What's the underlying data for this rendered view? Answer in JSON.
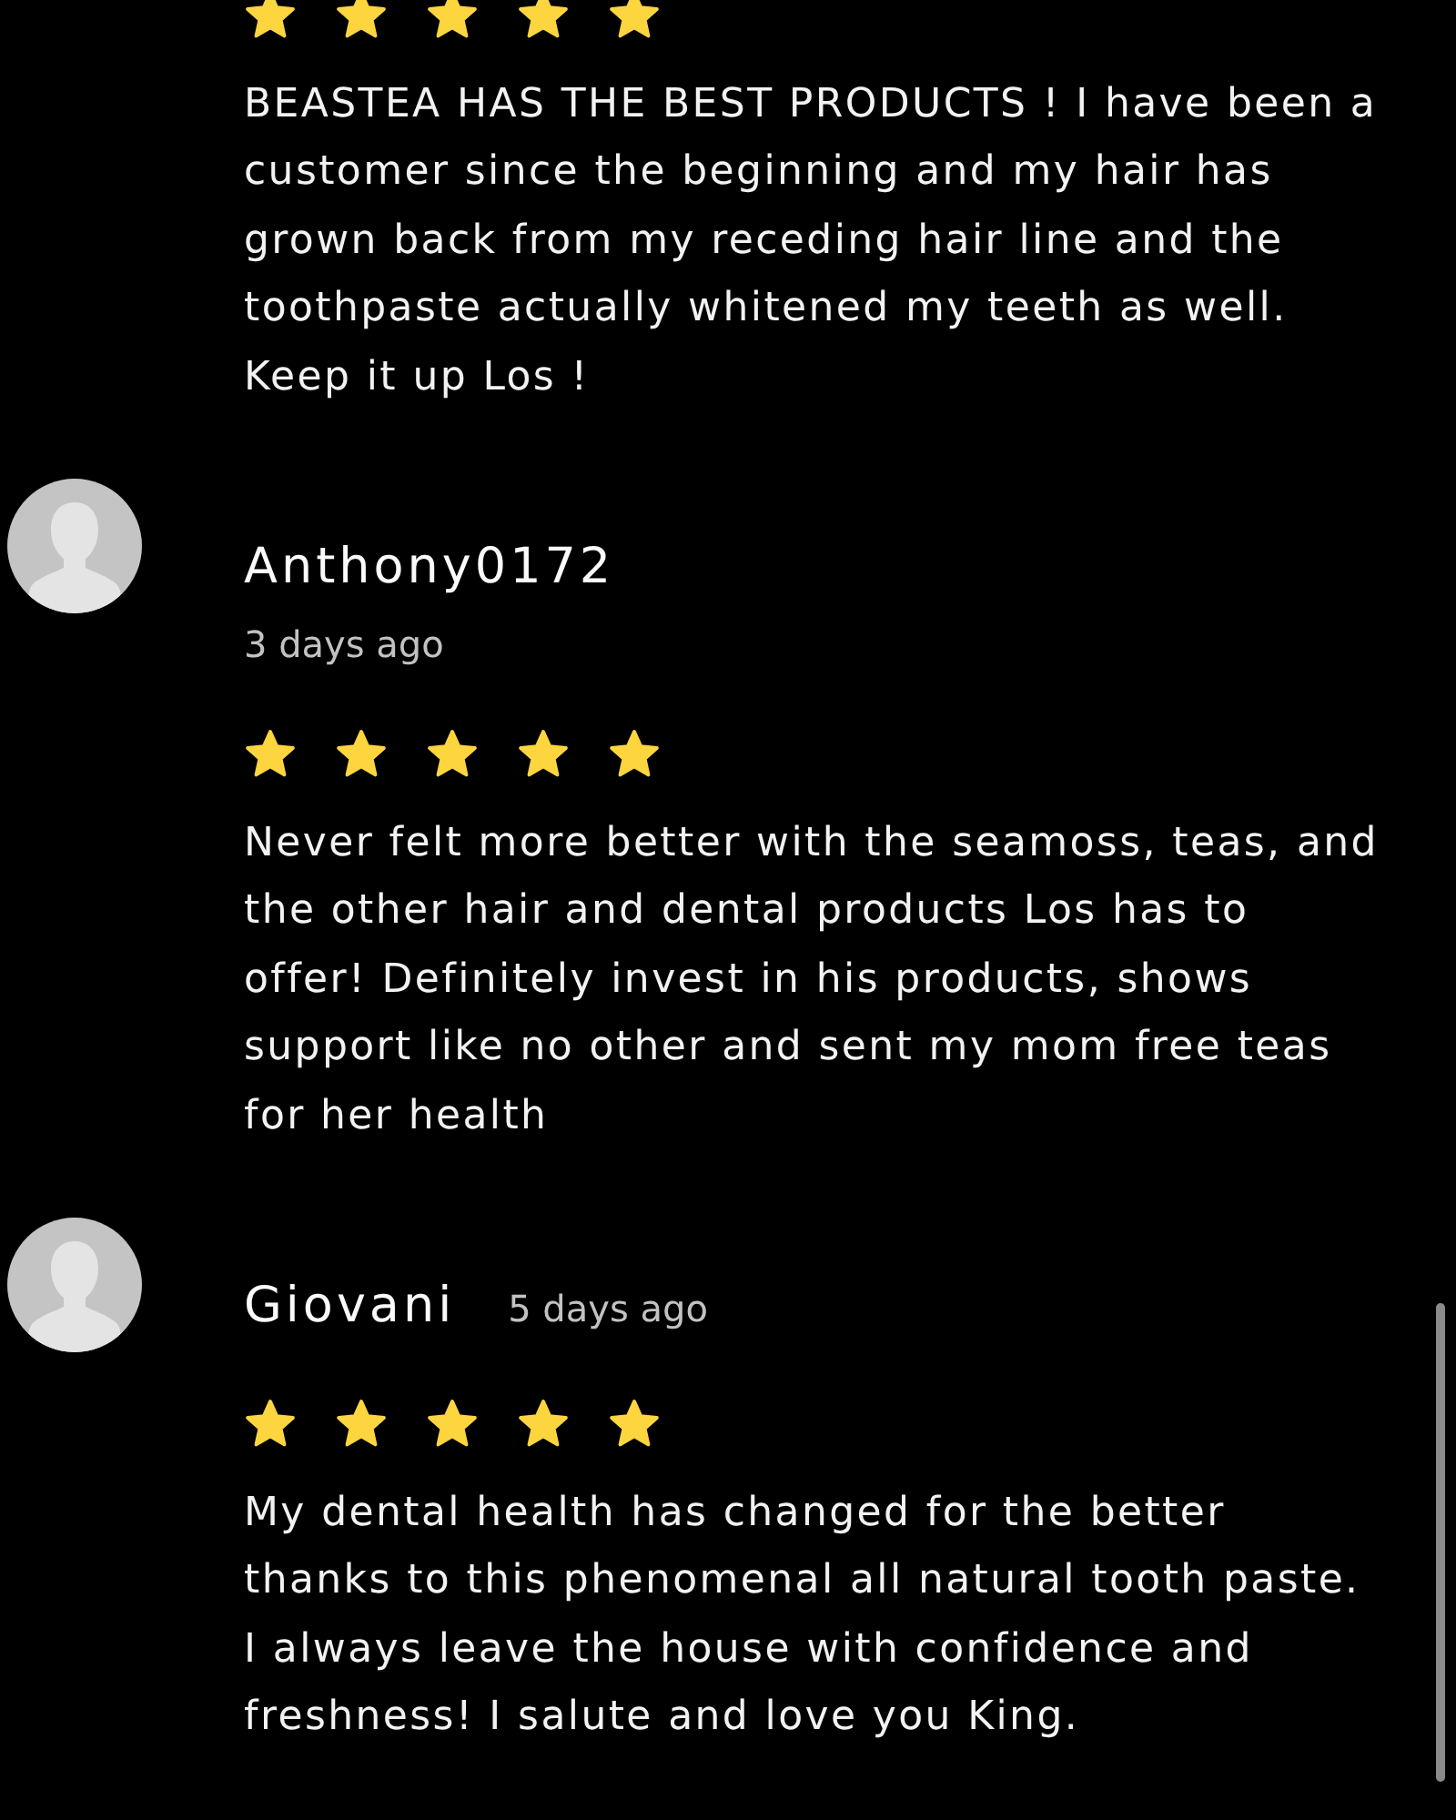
{
  "reviews": [
    {
      "stars": 5,
      "text": "BEASTEA HAS THE BEST PRODUCTS ! I have been a customer since the beginning and my hair has grown back from my receding hair line and the toothpaste actually whitened my teeth as well. Keep it up Los !"
    },
    {
      "author": "Anthony0172",
      "date": "3 days ago",
      "date_inline": false,
      "stars": 5,
      "text": "Never felt more better with the seamoss, teas, and the other hair and dental products Los has to offer! Definitely invest in his products, shows support like no other and sent my mom free teas for her health"
    },
    {
      "author": "Giovani",
      "date": "5 days ago",
      "date_inline": true,
      "stars": 5,
      "text": "My dental health has changed for the better thanks to this phenomenal all natural tooth paste. I always leave the house with confidence and freshness! I salute and love you King."
    }
  ]
}
